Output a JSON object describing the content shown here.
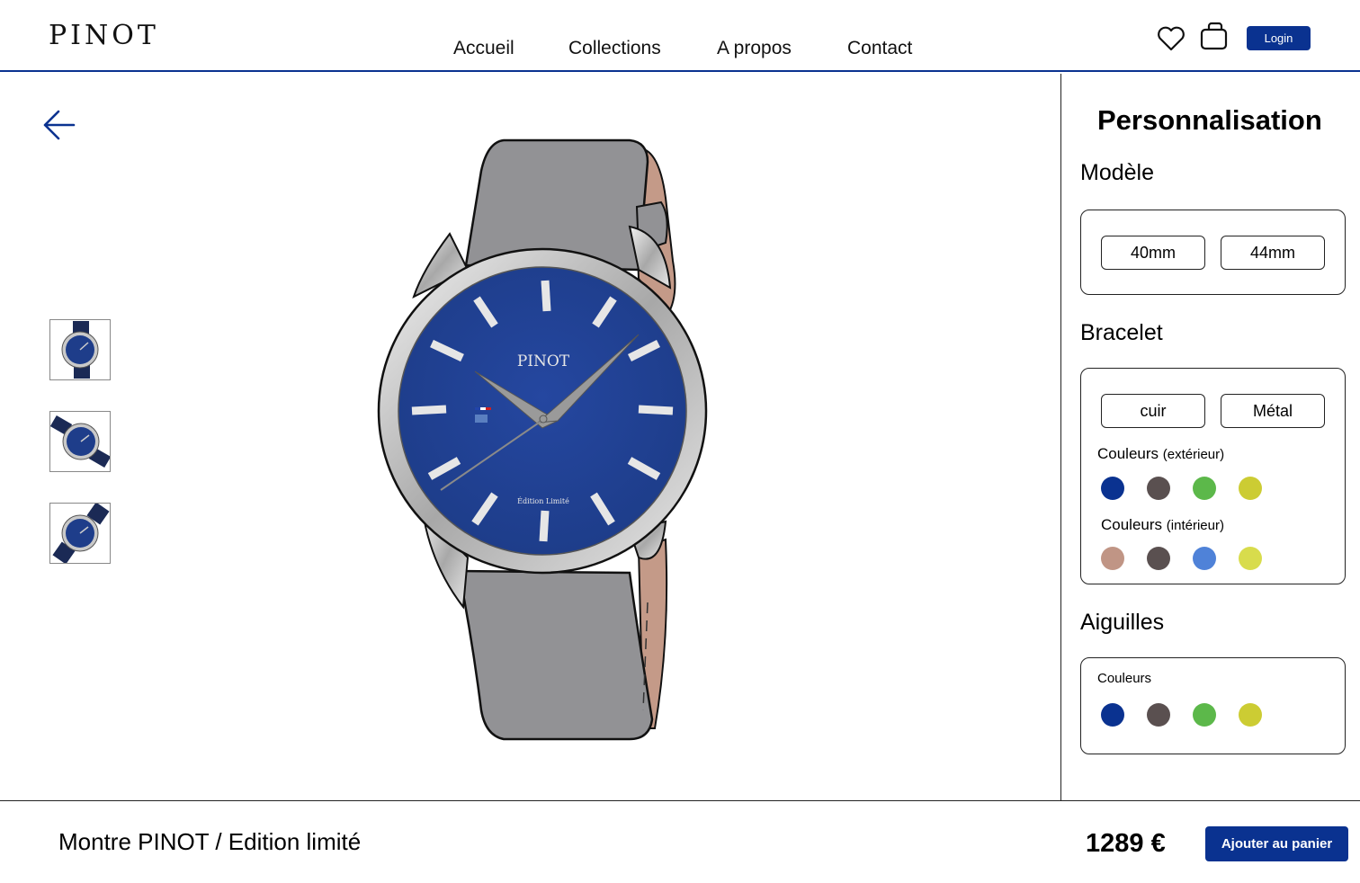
{
  "brand": {
    "logo": "PINOT"
  },
  "nav": {
    "items": [
      "Accueil",
      "Collections",
      "A propos",
      "Contact"
    ]
  },
  "header": {
    "login_label": "Login"
  },
  "watch": {
    "dial_brand": "PINOT",
    "dial_edition": "Édition Limité"
  },
  "sidebar": {
    "title": "Personnalisation",
    "modele": {
      "title": "Modèle",
      "options": [
        "40mm",
        "44mm"
      ]
    },
    "bracelet": {
      "title": "Bracelet",
      "options": [
        "cuir",
        "Métal"
      ],
      "ext_label": "Couleurs",
      "ext_note": "(extérieur)",
      "ext_colors": [
        "#0a3290",
        "#5a5050",
        "#5cb84a",
        "#cccc33"
      ],
      "int_label": "Couleurs",
      "int_note": "(intérieur)",
      "int_colors": [
        "#c09585",
        "#5a5050",
        "#4f82d8",
        "#d8dc4c"
      ]
    },
    "aiguilles": {
      "title": "Aiguilles",
      "colors_label": "Couleurs",
      "colors": [
        "#0a3290",
        "#5a5050",
        "#5cb84a",
        "#cccc33"
      ]
    }
  },
  "footer": {
    "product_name": "Montre PINOT / Edition limité",
    "price": "1289 €",
    "cart_label": "Ajouter au panier"
  },
  "colors": {
    "accent": "#0a3290",
    "dial": "#1e3d8a",
    "strap": "#929295"
  }
}
